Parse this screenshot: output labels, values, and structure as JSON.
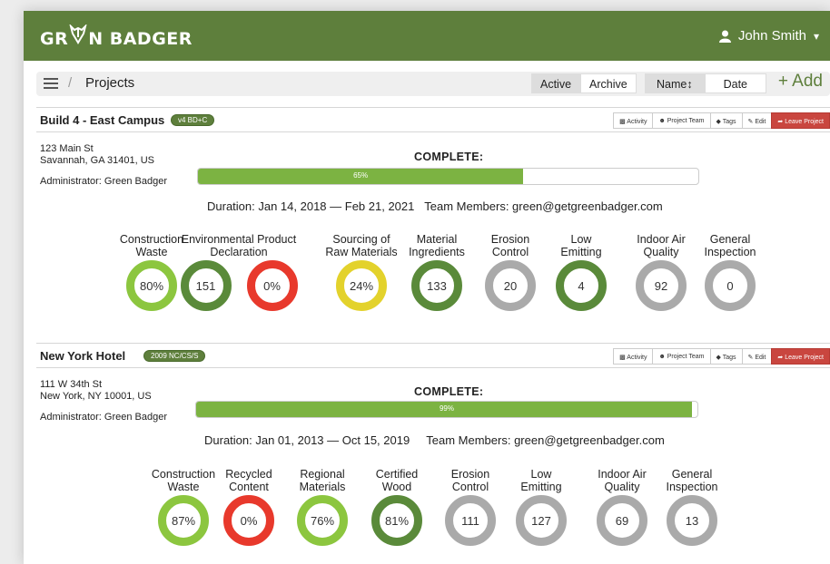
{
  "app": {
    "brand": "GR  N BADGER",
    "brand_left": "GR",
    "brand_right": "N BADGER"
  },
  "user": {
    "name": "John Smith",
    "icon": "person-icon",
    "caret": "▾"
  },
  "toolbar": {
    "separator": "/",
    "breadcrumb": "Projects",
    "filters": [
      "Active",
      "Archive"
    ],
    "sorts": [
      "Name↕",
      "Date"
    ],
    "add_label": "+ Add"
  },
  "colors": {
    "brand": "#5e7f3c",
    "light_green": "#8cc63f",
    "dark_green": "#5a8a3a",
    "red": "#e8392c",
    "yellow": "#e3d22c",
    "gray": "#aaaaaa",
    "leave": "#c9463f"
  },
  "actions": [
    "Activity",
    "Project Team",
    "Tags",
    "Edit",
    "Leave Project"
  ],
  "projects": [
    {
      "name": "Build 4 - East Campus",
      "tag": "v4 BD+C",
      "address_line1": "123 Main St",
      "address_line2": "Savannah, GA 31401, US",
      "admin": "Administrator: Green Badger",
      "complete_label": "COMPLETE:",
      "progress": 0.65,
      "progress_text": "65%",
      "duration": "Duration: Jan 14, 2018 — Feb 21, 2021",
      "team": "Team Members: green@getgreenbadger.com",
      "metrics": [
        {
          "label_line1": "Construction",
          "label_line2": "Waste",
          "value": "80%",
          "color": "#8cc63f"
        },
        {
          "label_line1": "Environmental Product",
          "label_line2": "Declaration",
          "value": "151",
          "color": "#5a8a3a"
        },
        {
          "label_line1": "",
          "label_line2": "",
          "value": "0%",
          "color": "#e8392c"
        },
        {
          "label_line1": "Sourcing of",
          "label_line2": "Raw Materials",
          "value": "24%",
          "color": "#e3d22c"
        },
        {
          "label_line1": "Material",
          "label_line2": "Ingredients",
          "value": "133",
          "color": "#5a8a3a"
        },
        {
          "label_line1": "Erosion",
          "label_line2": "Control",
          "value": "20",
          "color": "#aaaaaa"
        },
        {
          "label_line1": "Low",
          "label_line2": "Emitting",
          "value": "4",
          "color": "#5a8a3a"
        },
        {
          "label_line1": "Indoor Air",
          "label_line2": "Quality",
          "value": "92",
          "color": "#aaaaaa"
        },
        {
          "label_line1": "General",
          "label_line2": "Inspection",
          "value": "0",
          "color": "#aaaaaa"
        }
      ]
    },
    {
      "name": "New York Hotel",
      "tag": "2009 NC/CS/S",
      "address_line1": "111 W 34th St",
      "address_line2": "New York, NY 10001, US",
      "admin": "Administrator: Green Badger",
      "complete_label": "COMPLETE:",
      "progress": 0.99,
      "progress_text": "99%",
      "duration": "Duration: Jan 01, 2013 — Oct 15, 2019",
      "team": "Team Members: green@getgreenbadger.com",
      "metrics": [
        {
          "label_line1": "Construction",
          "label_line2": "Waste",
          "value": "87%",
          "color": "#8cc63f"
        },
        {
          "label_line1": "Recycled",
          "label_line2": "Content",
          "value": "0%",
          "color": "#e8392c"
        },
        {
          "label_line1": "Regional",
          "label_line2": "Materials",
          "value": "76%",
          "color": "#8cc63f"
        },
        {
          "label_line1": "Certified",
          "label_line2": "Wood",
          "value": "81%",
          "color": "#5a8a3a"
        },
        {
          "label_line1": "Erosion",
          "label_line2": "Control",
          "value": "111",
          "color": "#aaaaaa"
        },
        {
          "label_line1": "Low",
          "label_line2": "Emitting",
          "value": "127",
          "color": "#aaaaaa"
        },
        {
          "label_line1": "Indoor Air",
          "label_line2": "Quality",
          "value": "69",
          "color": "#aaaaaa"
        },
        {
          "label_line1": "General",
          "label_line2": "Inspection",
          "value": "13",
          "color": "#aaaaaa"
        }
      ]
    }
  ]
}
